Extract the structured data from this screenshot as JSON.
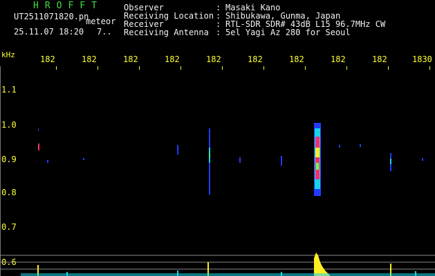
{
  "header": {
    "logo": "HROFFT",
    "filename": "UT2511071820.pn",
    "classification": "meteor",
    "datetime": "25.11.07 18:20",
    "count": "7..",
    "fields": [
      {
        "label": "Observer",
        "value": "Masaki Kano"
      },
      {
        "label": "Receiving Location",
        "value": "Shibukawa, Gunma, Japan"
      },
      {
        "label": "Receiver",
        "value": "RTL-SDR SDR# 43dB L15 96.7MHz CW"
      },
      {
        "label": "Receiving Antenna",
        "value": "5el Yagi Az 280 for Seoul"
      }
    ],
    "separator": ":"
  },
  "axis": {
    "y_unit": "kHz",
    "x_ticks": [
      "182",
      "182",
      "182",
      "182",
      "182",
      "182",
      "182",
      "182",
      "182",
      "1830"
    ],
    "y_ticks": [
      "1.1",
      "1.0",
      "0.9",
      "0.8",
      "0.7",
      "0.6"
    ]
  },
  "colors": {
    "background": "#000000",
    "header_text": "#f2f2f2",
    "logo": "#3ee03e",
    "axis_text": "#ffff33",
    "echo_core": "#ff2b6e",
    "echo_mid": "#19d4e6",
    "echo_edge": "#1f3cff",
    "echo_hot": "#ffee22"
  }
}
